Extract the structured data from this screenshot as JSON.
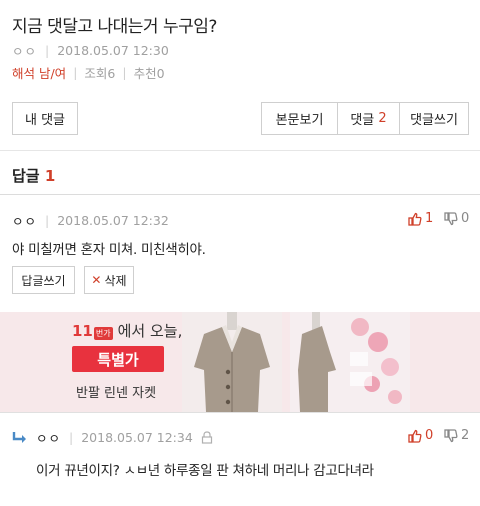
{
  "post": {
    "title": "지금 댓달고 나대는거 누구임?",
    "author": "ㅇㅇ",
    "date": "2018.05.07 12:30",
    "interpretation": "해석 남/여",
    "views": "조회6",
    "recommends": "추천0"
  },
  "buttons": {
    "my_comments": "내 댓글",
    "view_post": "본문보기",
    "comments_label": "댓글",
    "comments_count": "2",
    "write_comment": "댓글쓰기"
  },
  "replies_section": {
    "label": "답글",
    "count": "1"
  },
  "comments": [
    {
      "author": "ㅇㅇ",
      "date": "2018.05.07 12:32",
      "text": "야 미칠꺼면 혼자 미쳐. 미친색히야.",
      "upvotes": "1",
      "downvotes": "0",
      "reply_button": "답글쓰기",
      "delete_button": "삭제"
    },
    {
      "author": "ㅇㅇ",
      "date": "2018.05.07 12:34",
      "text": "이거 뀨년이지? ㅅㅂ년 하루종일 판 쳐하네 머리나 감고다녀라",
      "upvotes": "0",
      "downvotes": "2"
    }
  ],
  "ad": {
    "brand_number": "11",
    "brand_badge": "번가",
    "brand_text": "에서 오늘,",
    "badge": "특별가",
    "product": "반팔 린넨 자켓"
  },
  "colors": {
    "accent_red": "#d0402a",
    "ad_background": "#f7e8ea",
    "ad_badge": "#e8323e"
  }
}
